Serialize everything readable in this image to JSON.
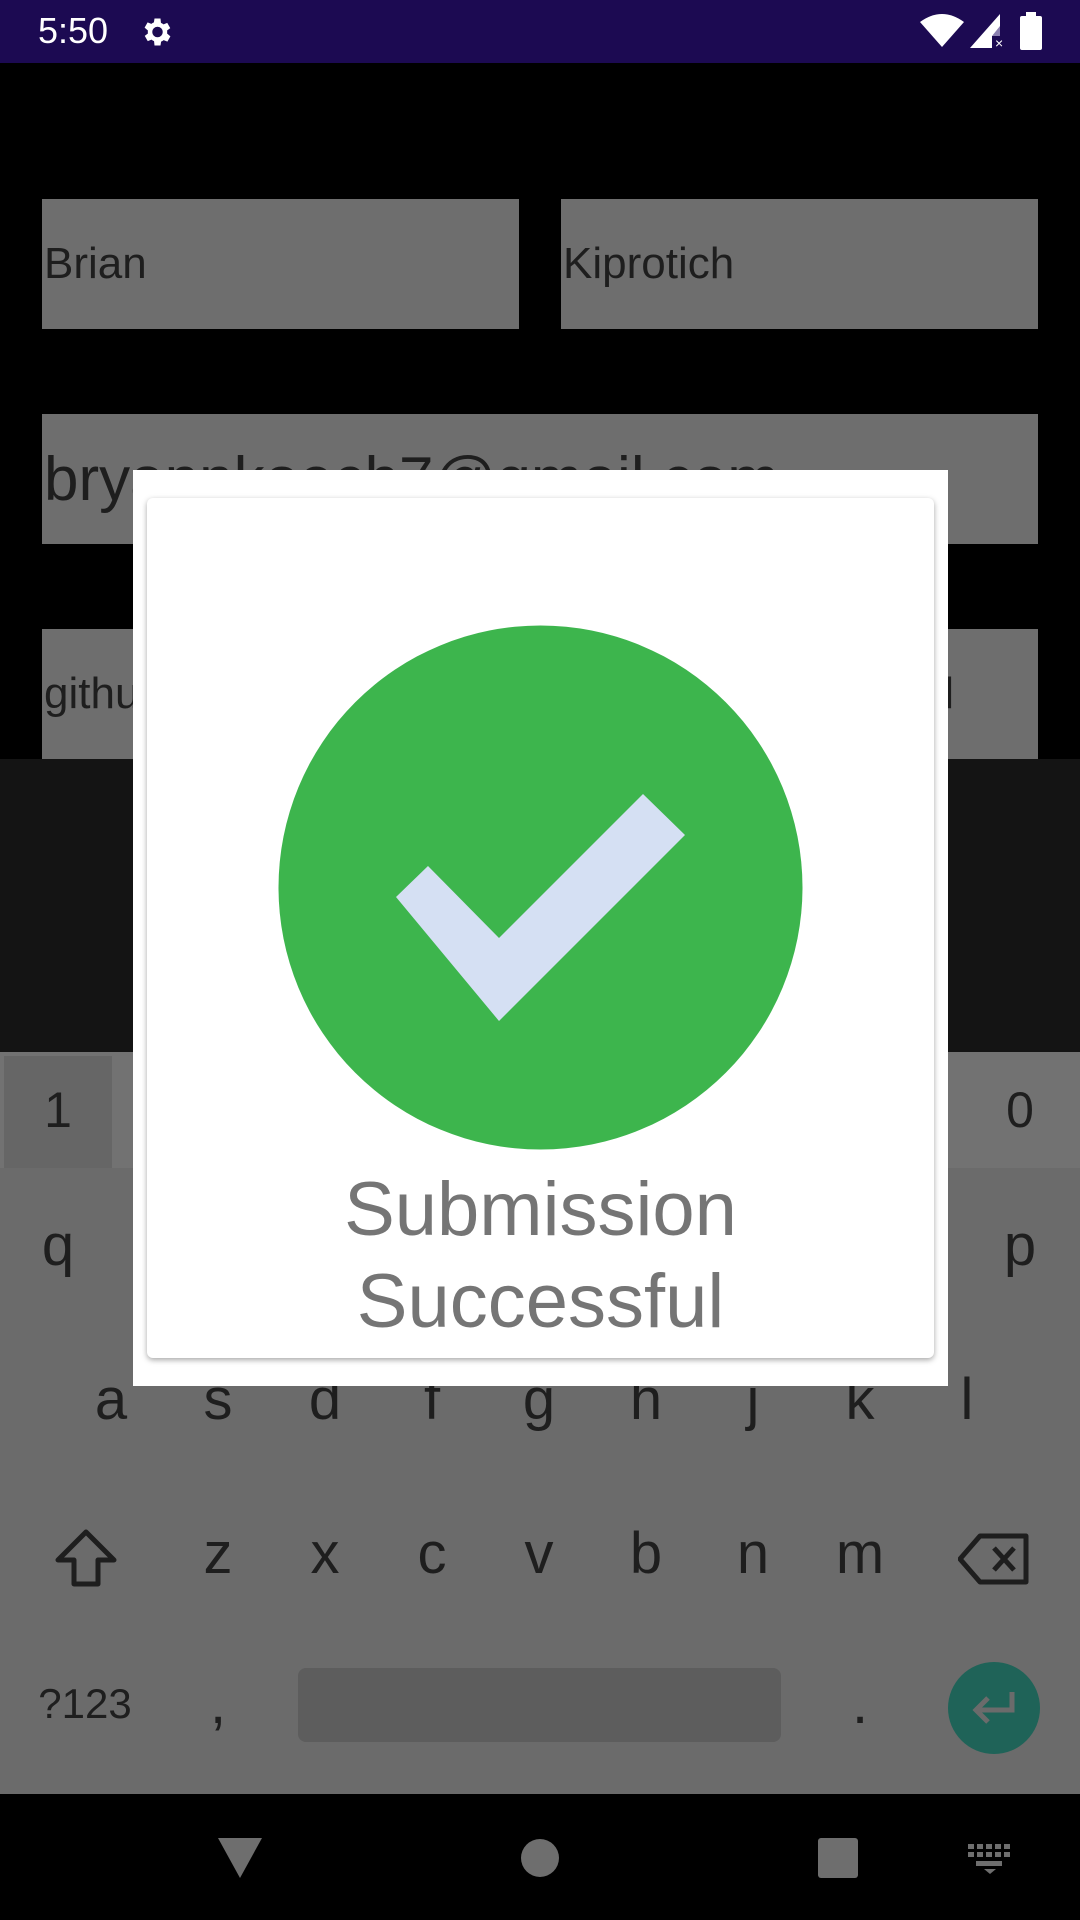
{
  "status_bar": {
    "time": "5:50",
    "icons": [
      "gear-icon",
      "wifi-icon",
      "signal-icon",
      "battery-icon"
    ]
  },
  "form": {
    "first_name": "Brian",
    "last_name": "Kiprotich",
    "email": "bryannkoech7@gmail.com",
    "github_visible_start": "githu",
    "github_visible_end": "l"
  },
  "keyboard": {
    "number_row": [
      "1",
      "0"
    ],
    "row1": [
      "q",
      "p"
    ],
    "row2": [
      "a",
      "s",
      "d",
      "f",
      "g",
      "h",
      "j",
      "k",
      "l"
    ],
    "row3": [
      "z",
      "x",
      "c",
      "v",
      "b",
      "n",
      "m"
    ],
    "symbols_label": "?123",
    "comma": ",",
    "period": "."
  },
  "dialog": {
    "message_line1": "Submission",
    "message_line2": "Successful",
    "icon": "check-circle-icon",
    "colors": {
      "circle": "#3db54d",
      "check": "#d5e0f3"
    }
  },
  "nav_bar": {
    "icons": [
      "back-icon",
      "home-icon",
      "recents-icon",
      "keyboard-switch-icon"
    ]
  }
}
